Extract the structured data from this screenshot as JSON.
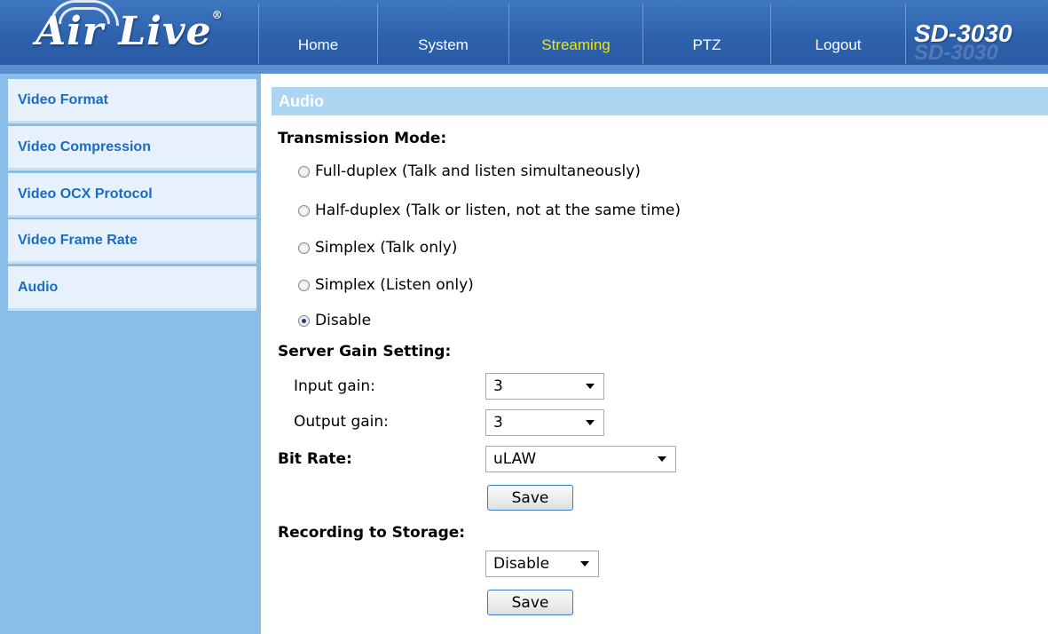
{
  "header": {
    "logo_text": "Air Live",
    "logo_mark": "®",
    "model": "SD-3030",
    "nav": [
      {
        "label": "Home"
      },
      {
        "label": "System"
      },
      {
        "label": "Streaming",
        "active": true
      },
      {
        "label": "PTZ"
      },
      {
        "label": "Logout"
      }
    ]
  },
  "sidebar": {
    "items": [
      {
        "label": "Video Format"
      },
      {
        "label": "Video Compression"
      },
      {
        "label": "Video OCX Protocol"
      },
      {
        "label": "Video Frame Rate"
      },
      {
        "label": "Audio"
      }
    ]
  },
  "main": {
    "section_title": "Audio",
    "transmission": {
      "label": "Transmission Mode:",
      "options": [
        {
          "label": "Full-duplex (Talk and listen simultaneously)",
          "checked": false
        },
        {
          "label": "Half-duplex (Talk or listen, not at the same time)",
          "checked": false
        },
        {
          "label": "Simplex (Talk only)",
          "checked": false
        },
        {
          "label": "Simplex (Listen only)",
          "checked": false
        },
        {
          "label": "Disable",
          "checked": true
        }
      ]
    },
    "gain": {
      "label": "Server Gain Setting:",
      "input_label": "Input gain:",
      "input_value": "3",
      "output_label": "Output gain:",
      "output_value": "3"
    },
    "bitrate": {
      "label": "Bit Rate:",
      "value": "uLAW",
      "save_label": "Save"
    },
    "recording": {
      "label": "Recording to Storage:",
      "value": "Disable",
      "save_label": "Save"
    }
  },
  "colors": {
    "header_blue": "#2e62ad",
    "active_nav": "#f2e600",
    "sidebar_bg": "#8bbde9",
    "sidebar_item_text": "#1a6cc4",
    "section_bar": "#acd6f2"
  }
}
